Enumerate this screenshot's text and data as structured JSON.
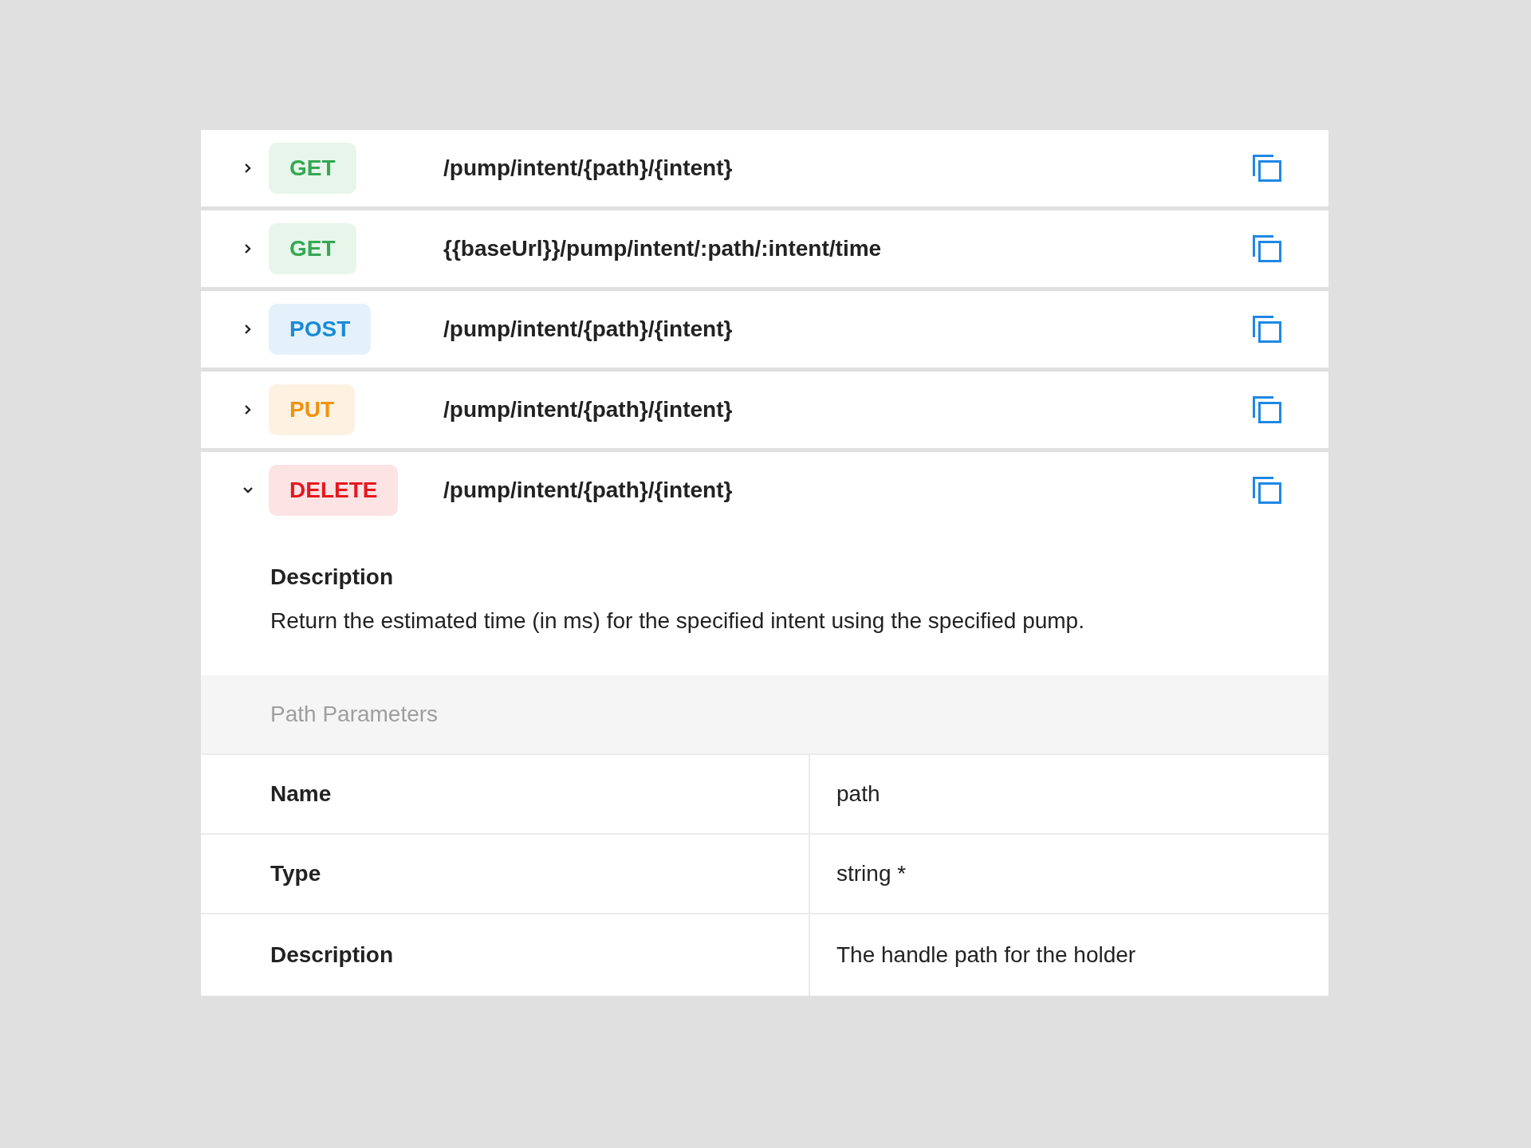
{
  "endpoints": [
    {
      "method": "GET",
      "color": "#34a853",
      "path": "/pump/intent/{path}/{intent}",
      "expanded": false
    },
    {
      "method": "GET",
      "color": "#34a853",
      "path": "{{baseUrl}}/pump/intent/:path/:intent/time",
      "expanded": false
    },
    {
      "method": "POST",
      "color": "#1a8ad8",
      "path": "/pump/intent/{path}/{intent}",
      "expanded": false
    },
    {
      "method": "PUT",
      "color": "#f0920e",
      "path": "/pump/intent/{path}/{intent}",
      "expanded": false
    },
    {
      "method": "DELETE",
      "color": "#e4181e",
      "path": "/pump/intent/{path}/{intent}",
      "expanded": true,
      "details": {
        "description_heading": "Description",
        "description": "Return the estimated time (in ms) for the specified intent using the specified pump.",
        "parameters": {
          "title": "Path Parameters",
          "rows": [
            {
              "label": "Name",
              "value": "path"
            },
            {
              "label": "Type",
              "value": "string *"
            },
            {
              "label": "Description",
              "value": "The handle path for the holder"
            }
          ]
        }
      }
    }
  ]
}
